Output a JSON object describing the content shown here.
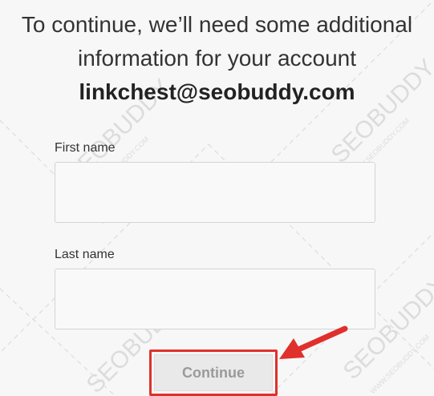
{
  "heading": {
    "line1": "To continue, we’ll need some additional",
    "line2": "information for your account",
    "account_email": "linkchest@seobuddy.com"
  },
  "form": {
    "first_name": {
      "label": "First name",
      "value": "",
      "placeholder": ""
    },
    "last_name": {
      "label": "Last name",
      "value": "",
      "placeholder": ""
    },
    "continue_label": "Continue"
  },
  "watermark": {
    "brand": "SEOBUDDY",
    "url": "WWW.SEOBUDDY.COM"
  },
  "colors": {
    "background": "#f7f7f7",
    "highlight": "#e0302c",
    "button_bg": "#e9e9e9",
    "button_text": "#9a9a9a"
  },
  "icons": {
    "annotation_arrow": "arrow-pointing-left-icon"
  }
}
